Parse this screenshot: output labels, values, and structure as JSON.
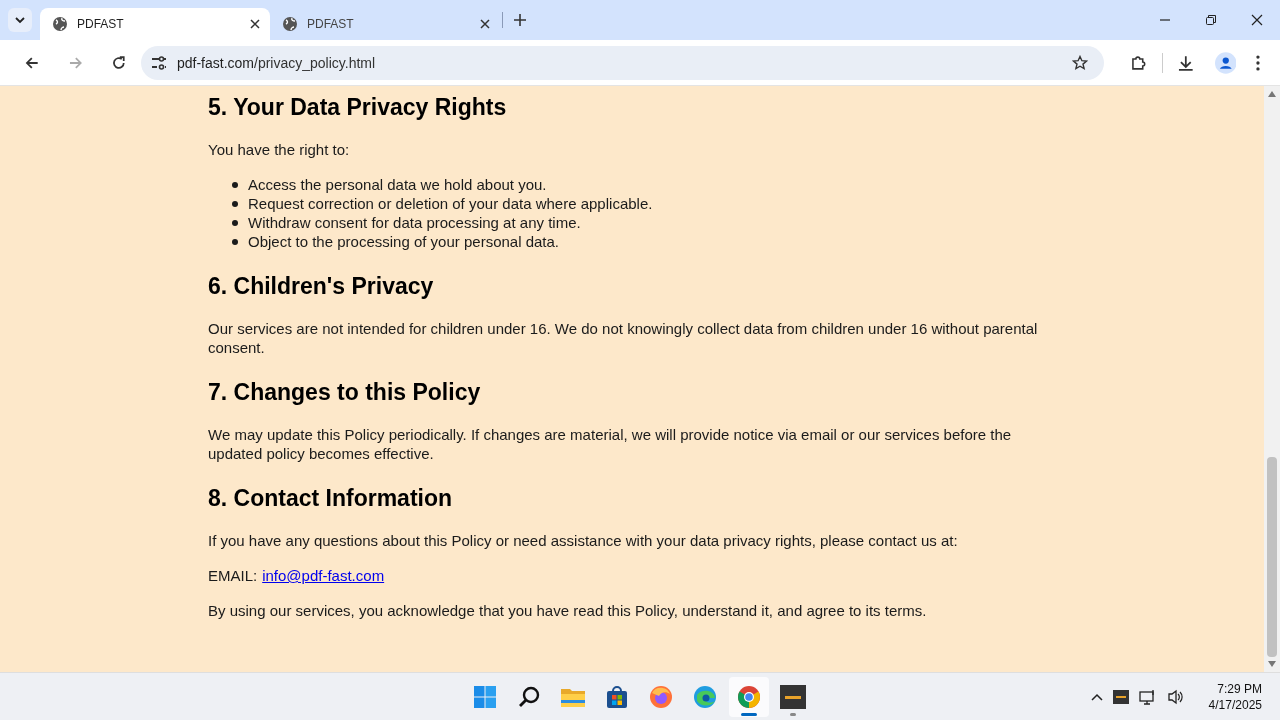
{
  "tabs": [
    {
      "title": "PDFAST",
      "selected": true
    },
    {
      "title": "PDFAST",
      "selected": false
    }
  ],
  "address": {
    "host": "pdf-fast.com",
    "path": "/privacy_policy.html"
  },
  "sections": [
    {
      "heading": "5. Your Data Privacy Rights",
      "blocks": [
        {
          "kind": "paragraph",
          "text": "You have the right to:"
        },
        {
          "kind": "list",
          "items": [
            "Access the personal data we hold about you.",
            "Request correction or deletion of your data where applicable.",
            "Withdraw consent for data processing at any time.",
            "Object to the processing of your personal data."
          ]
        }
      ]
    },
    {
      "heading": "6. Children's Privacy",
      "blocks": [
        {
          "kind": "paragraph",
          "text": "Our services are not intended for children under 16. We do not knowingly collect data from children under 16 without parental consent."
        }
      ]
    },
    {
      "heading": "7. Changes to this Policy",
      "blocks": [
        {
          "kind": "paragraph",
          "text": "We may update this Policy periodically. If changes are material, we will provide notice via email or our services before the updated policy becomes effective."
        }
      ]
    },
    {
      "heading": "8. Contact Information",
      "blocks": [
        {
          "kind": "paragraph",
          "text": "If you have any questions about this Policy or need assistance with your data privacy rights, please contact us at:"
        },
        {
          "kind": "email",
          "label": "EMAIL:",
          "link": "info@pdf-fast.com"
        },
        {
          "kind": "paragraph",
          "text": "By using our services, you acknowledge that you have read this Policy, understand it, and agree to its terms."
        }
      ]
    }
  ],
  "taskbar": [
    {
      "kind": "start",
      "selected": false,
      "running": false
    },
    {
      "kind": "search",
      "selected": false,
      "running": false
    },
    {
      "kind": "folder",
      "selected": false,
      "running": false
    },
    {
      "kind": "store",
      "selected": false,
      "running": false
    },
    {
      "kind": "firefox",
      "selected": false,
      "running": false
    },
    {
      "kind": "edge",
      "selected": false,
      "running": false
    },
    {
      "kind": "chrome",
      "selected": true,
      "running": true
    },
    {
      "kind": "app",
      "selected": false,
      "running": true
    }
  ],
  "clock": {
    "time": "7:29 PM",
    "date": "4/17/2025"
  }
}
